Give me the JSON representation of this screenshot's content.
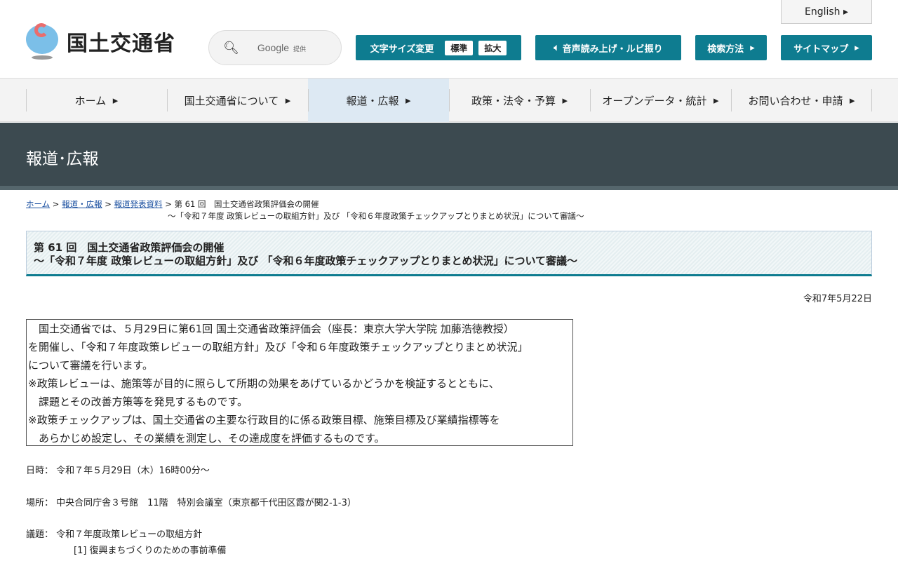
{
  "header": {
    "logo_text": "国土交通省",
    "search_provider": "Google",
    "search_provided": "提供",
    "english": "English",
    "font_size_label": "文字サイズ変更",
    "font_standard": "標準",
    "font_large": "拡大",
    "speech": "音声読み上げ・ルビ振り",
    "search_method": "検索方法",
    "sitemap": "サイトマップ"
  },
  "nav": [
    "ホーム",
    "国土交通省について",
    "報道・広報",
    "政策・法令・予算",
    "オープンデータ・統計",
    "お問い合わせ・申請"
  ],
  "banner": "報道･広報",
  "breadcrumb": {
    "home": "ホーム",
    "press": "報道・広報",
    "release": "報道発表資料",
    "current1": "第 61 回　国土交通省政策評価会の開催",
    "current2": "～「令和７年度 政策レビューの取組方針」及び 「令和６年度政策チェックアップとりまとめ状況」について審議～"
  },
  "title": {
    "line1": "第 61 回　国土交通省政策評価会の開催",
    "line2": "～「令和７年度 政策レビューの取組方針」及び 「令和６年度政策チェックアップとりまとめ状況」について審議～"
  },
  "date": "令和7年5月22日",
  "body": [
    "　国土交通省では、５月29日に第61回 国土交通省政策評価会（座長：東京大学大学院 加藤浩徳教授）",
    "を開催し、「令和７年度政策レビューの取組方針」及び「令和６年度政策チェックアップとりまとめ状況」",
    "について審議を行います。",
    "※政策レビューは、施策等が目的に照らして所期の効果をあげているかどうかを検証するとともに、",
    "　課題とその改善方策等を発見するものです。",
    "※政策チェックアップは、国土交通省の主要な行政目的に係る政策目標、施策目標及び業績指標等を",
    "　あらかじめ設定し、その業績を測定し、その達成度を評価するものです。"
  ],
  "info": {
    "datetime": "日時： 令和７年５月29日（木）16時00分～",
    "place": "場所： 中央合同庁舎３号館　11階　特別会議室（東京都千代田区霞が関2-1-3）",
    "agenda": "議題： 令和７年度政策レビューの取組方針",
    "item1": "[1]  復興まちづくりのための事前準備"
  }
}
